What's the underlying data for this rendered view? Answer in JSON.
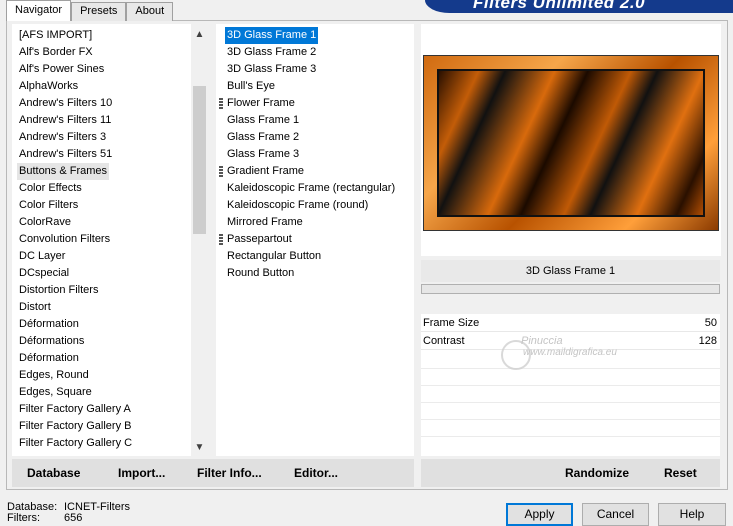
{
  "tabs": [
    {
      "label": "Navigator",
      "active": true
    },
    {
      "label": "Presets",
      "active": false
    },
    {
      "label": "About",
      "active": false
    }
  ],
  "banner": {
    "title": "Filters Unlimited 2.0"
  },
  "categories": {
    "selected": "Buttons & Frames",
    "items": [
      "[AFS IMPORT]",
      "Alf's Border FX",
      "Alf's Power Sines",
      "AlphaWorks",
      "Andrew's Filters 10",
      "Andrew's Filters 11",
      "Andrew's Filters 3",
      "Andrew's Filters 51",
      "Buttons & Frames",
      "Color Effects",
      "Color Filters",
      "ColorRave",
      "Convolution Filters",
      "DC Layer",
      "DCspecial",
      "Distortion Filters",
      "Distort",
      "Déformation",
      "Déformations",
      "Déformation",
      "Edges, Round",
      "Edges, Square",
      "Filter Factory Gallery A",
      "Filter Factory Gallery B",
      "Filter Factory Gallery C"
    ]
  },
  "filters": {
    "selected": "3D Glass Frame 1",
    "items": [
      {
        "label": "3D Glass Frame 1",
        "group": false
      },
      {
        "label": "3D Glass Frame 2",
        "group": false
      },
      {
        "label": "3D Glass Frame 3",
        "group": false
      },
      {
        "label": "Bull's Eye",
        "group": false
      },
      {
        "label": "Flower Frame",
        "group": true
      },
      {
        "label": "Glass Frame 1",
        "group": false
      },
      {
        "label": "Glass Frame 2",
        "group": false
      },
      {
        "label": "Glass Frame 3",
        "group": false
      },
      {
        "label": "Gradient Frame",
        "group": true
      },
      {
        "label": "Kaleidoscopic Frame (rectangular)",
        "group": false
      },
      {
        "label": "Kaleidoscopic Frame (round)",
        "group": false
      },
      {
        "label": "Mirrored Frame",
        "group": false
      },
      {
        "label": "Passepartout",
        "group": true
      },
      {
        "label": "Rectangular Button",
        "group": false
      },
      {
        "label": "Round Button",
        "group": false
      }
    ]
  },
  "preview": {
    "filter_name": "3D Glass Frame 1"
  },
  "params": [
    {
      "label": "Frame Size",
      "value": "50"
    },
    {
      "label": "Contrast",
      "value": "128"
    }
  ],
  "watermark": {
    "line1": "Pinuccia",
    "line2": "www.maildigrafica.eu"
  },
  "left_buttons": {
    "database": "Database",
    "import": "Import...",
    "filter_info": "Filter Info...",
    "editor": "Editor..."
  },
  "right_buttons": {
    "randomize": "Randomize",
    "reset": "Reset"
  },
  "status": {
    "database_label": "Database:",
    "database_value": "ICNET-Filters",
    "filters_label": "Filters:",
    "filters_value": "656"
  },
  "dialog_buttons": {
    "apply": "Apply",
    "cancel": "Cancel",
    "help": "Help"
  }
}
